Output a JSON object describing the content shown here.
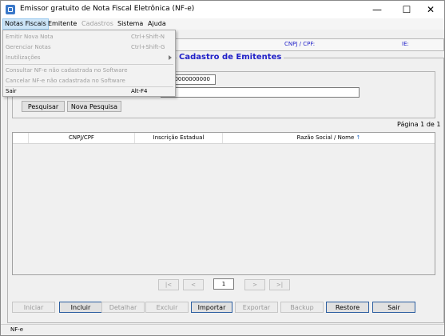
{
  "window": {
    "title": "Emissor gratuito de Nota Fiscal Eletrônica (NF-e)",
    "minimize": "—",
    "maximize": "☐",
    "close": "✕"
  },
  "menubar": {
    "items": [
      "Notas Fiscais",
      "Emitente",
      "Cadastros",
      "Sistema",
      "Ajuda"
    ]
  },
  "dropdown": {
    "items": [
      {
        "label": "Emitir Nova Nota",
        "shortcut": "Ctrl+Shift-N"
      },
      {
        "label": "Gerenciar Notas",
        "shortcut": "Ctrl+Shift-G"
      },
      {
        "label": "Inutilizações",
        "shortcut": ""
      },
      {
        "label": "Consultar NF-e não cadastrada no Software",
        "shortcut": ""
      },
      {
        "label": "Cancelar NF-e não cadastrada no Software",
        "shortcut": ""
      },
      {
        "label": "Sair",
        "shortcut": "Alt-F4"
      }
    ]
  },
  "infobar": {
    "cnpj_label": "CNPJ / CPF:",
    "ie_label": "IE:"
  },
  "panel": {
    "title": "Cadastro de Emitentes"
  },
  "filter": {
    "cnpj_value": "00000000000",
    "name_value": "",
    "search_button": "Pesquisar",
    "new_search_button": "Nova Pesquisa"
  },
  "pagination": {
    "page_info": "Página 1 de 1",
    "current_page": "1",
    "first": "|<",
    "prev": "<",
    "next": ">",
    "last": ">|"
  },
  "grid": {
    "columns": [
      "CNPJ/CPF",
      "Inscrição Estadual",
      "Razão Social / Nome"
    ],
    "sort_icon": "↑",
    "rows": []
  },
  "actions": {
    "iniciar": "Iniciar",
    "incluir": "Incluir",
    "detalhar": "Detalhar",
    "excluir": "Excluir",
    "importar": "Importar",
    "exportar": "Exportar",
    "backup": "Backup",
    "restore": "Restore",
    "sair": "Sair"
  },
  "statusbar": {
    "text": "NF-e"
  }
}
